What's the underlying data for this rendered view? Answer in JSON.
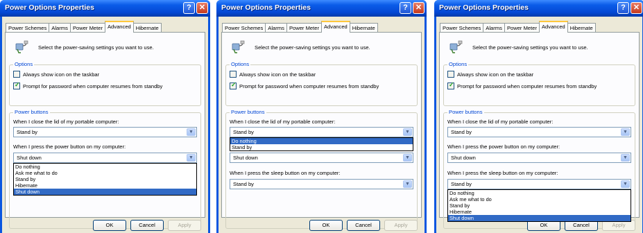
{
  "title": "Power Options Properties",
  "help_glyph": "?",
  "close_glyph": "✕",
  "tabs": [
    "Power Schemes",
    "Alarms",
    "Power Meter",
    "Advanced",
    "Hibernate"
  ],
  "intro": "Select the power-saving settings you want to use.",
  "options": {
    "legend": "Options",
    "always_show_icon": {
      "label": "Always show icon on the taskbar",
      "checked": false
    },
    "prompt_password": {
      "label": "Prompt for password when computer resumes from standby",
      "checked": true
    }
  },
  "power_buttons": {
    "legend": "Power buttons",
    "lid_label": "When I close the lid of my portable computer:",
    "power_label": "When I press the power button on my computer:",
    "sleep_label": "When I press the sleep button on my computer:"
  },
  "buttons": {
    "ok": "OK",
    "cancel": "Cancel",
    "apply": "Apply"
  },
  "windows": [
    {
      "lid_value": "Stand by",
      "power_value": "Shut down",
      "power_dropdown": [
        "Do nothing",
        "Ask me what to do",
        "Stand by",
        "Hibernate",
        "Shut down"
      ],
      "power_dropdown_selected": "Shut down"
    },
    {
      "lid_value": "Stand by",
      "lid_dropdown": [
        "Do nothing",
        "Stand by"
      ],
      "lid_dropdown_selected": "Do nothing",
      "power_value": "Shut down",
      "sleep_value": "Stand by"
    },
    {
      "lid_value": "Stand by",
      "power_value": "Shut down",
      "sleep_value": "Stand by",
      "sleep_dropdown": [
        "Do nothing",
        "Ask me what to do",
        "Stand by",
        "Hibernate",
        "Shut down"
      ],
      "sleep_dropdown_selected": "Shut down"
    }
  ],
  "colors": {
    "title_bar": "#0a56e0",
    "selection": "#316ac5",
    "group_legend": "#0046d5",
    "active_tab": "#ffc83c"
  }
}
